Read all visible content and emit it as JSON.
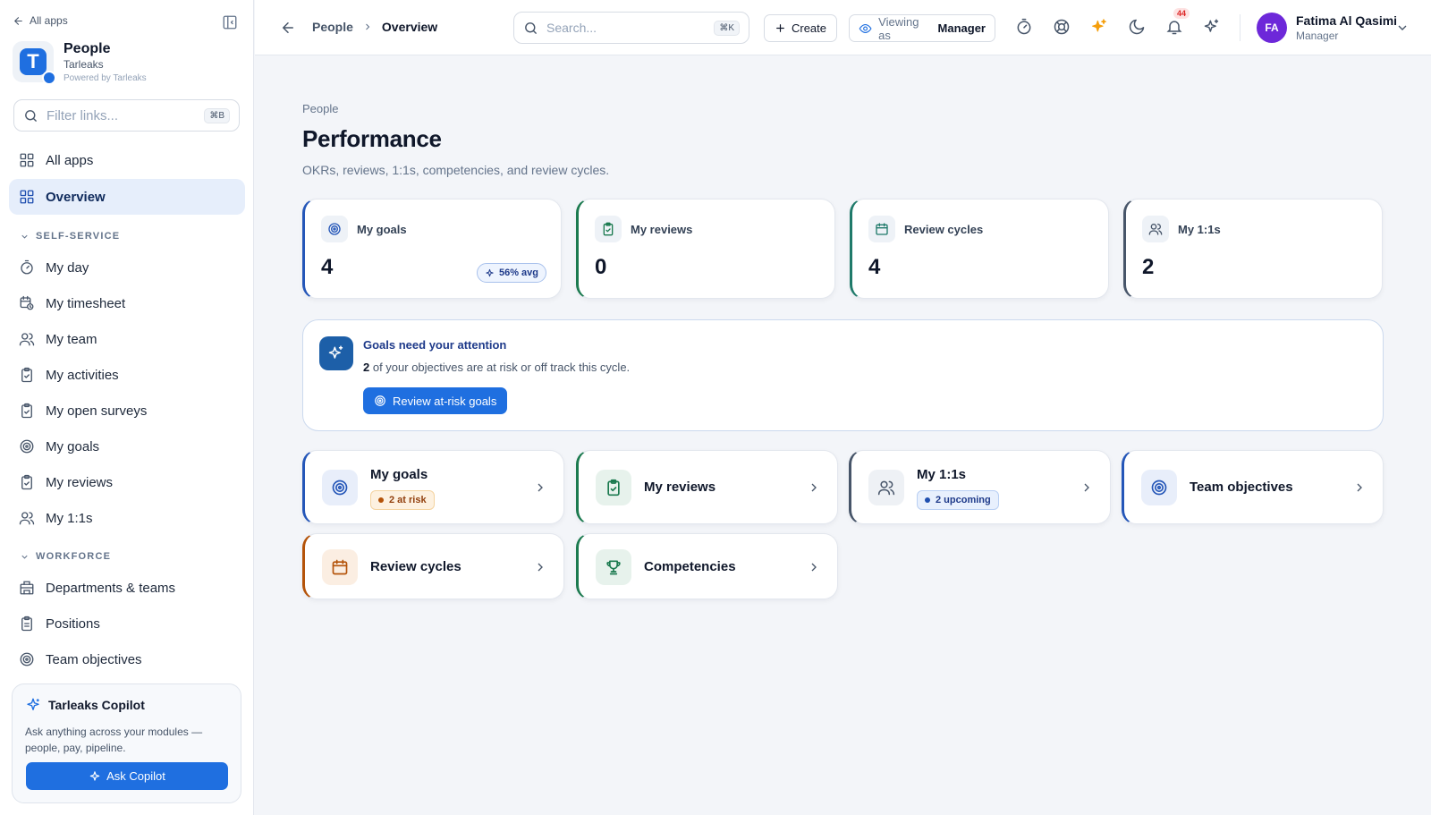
{
  "sidebar": {
    "all_apps": "All apps",
    "brand": {
      "name": "People",
      "org": "Tarleaks",
      "powered": "Powered by Tarleaks",
      "logo_letter": "T"
    },
    "filter": {
      "placeholder": "Filter links...",
      "shortcut": "⌘B"
    },
    "items_top": [
      {
        "label": "All apps",
        "icon": "grid-icon"
      },
      {
        "label": "Overview",
        "icon": "grid-icon",
        "active": true
      }
    ],
    "sections": [
      {
        "title": "SELF-SERVICE",
        "items": [
          {
            "label": "My day",
            "icon": "timer-icon"
          },
          {
            "label": "My timesheet",
            "icon": "calendar-clock-icon"
          },
          {
            "label": "My team",
            "icon": "users-icon"
          },
          {
            "label": "My activities",
            "icon": "clipboard-check-icon"
          },
          {
            "label": "My open surveys",
            "icon": "clipboard-check-icon"
          },
          {
            "label": "My goals",
            "icon": "target-icon"
          },
          {
            "label": "My reviews",
            "icon": "clipboard-check-icon"
          },
          {
            "label": "My 1:1s",
            "icon": "users-icon"
          }
        ]
      },
      {
        "title": "WORKFORCE",
        "items": [
          {
            "label": "Departments & teams",
            "icon": "building-icon"
          },
          {
            "label": "Positions",
            "icon": "clipboard-icon"
          },
          {
            "label": "Team objectives",
            "icon": "target-icon"
          }
        ]
      }
    ],
    "copilot": {
      "title": "Tarleaks Copilot",
      "description": "Ask anything across your modules — people, pay, pipeline.",
      "button": "Ask Copilot"
    }
  },
  "topbar": {
    "breadcrumb": [
      "People",
      "Overview"
    ],
    "search": {
      "placeholder": "Search...",
      "shortcut": "⌘K"
    },
    "create": "Create",
    "viewing_as": {
      "prefix": "Viewing as",
      "role": "Manager"
    },
    "notifications_count": "44",
    "user": {
      "initials": "FA",
      "name": "Fatima Al Qasimi",
      "role": "Manager"
    }
  },
  "page": {
    "eyebrow": "People",
    "title": "Performance",
    "subtitle": "OKRs, reviews, 1:1s, competencies, and review cycles."
  },
  "stats": [
    {
      "label": "My goals",
      "value": "4",
      "pill": "56% avg",
      "accent": "#2456b8",
      "icon": "target-icon"
    },
    {
      "label": "My reviews",
      "value": "0",
      "accent": "#1b7a4f",
      "icon": "clipboard-check-icon"
    },
    {
      "label": "Review cycles",
      "value": "4",
      "accent": "#1f7a6a",
      "icon": "calendar-icon"
    },
    {
      "label": "My 1:1s",
      "value": "2",
      "accent": "#475569",
      "icon": "users-icon"
    }
  ],
  "attention": {
    "title": "Goals need your attention",
    "count": "2",
    "text": " of your objectives are at risk or off track this cycle.",
    "button": "Review at-risk goals"
  },
  "quick_links": [
    {
      "title": "My goals",
      "badge": "2 at risk",
      "badge_tone": "amber",
      "accent": "#2456b8",
      "icon": "target-icon"
    },
    {
      "title": "My reviews",
      "accent": "#1b7a4f",
      "icon": "clipboard-check-icon"
    },
    {
      "title": "My 1:1s",
      "badge": "2 upcoming",
      "badge_tone": "blue",
      "accent": "#475569",
      "icon": "users-icon"
    },
    {
      "title": "Team objectives",
      "accent": "#2456b8",
      "icon": "target-icon"
    },
    {
      "title": "Review cycles",
      "accent": "#b45309",
      "icon": "calendar-icon"
    },
    {
      "title": "Competencies",
      "accent": "#1b7a4f",
      "icon": "trophy-icon"
    }
  ]
}
